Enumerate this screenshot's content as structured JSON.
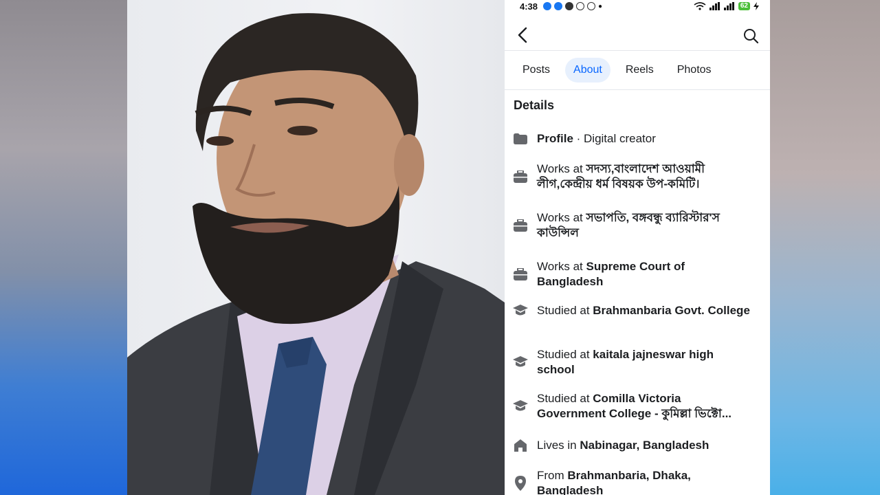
{
  "status_bar": {
    "time": "4:38",
    "battery": "62"
  },
  "header": {
    "back_icon": "chevron-left-icon",
    "search_icon": "search-icon"
  },
  "tabs": [
    {
      "label": "Posts",
      "active": false
    },
    {
      "label": "About",
      "active": true
    },
    {
      "label": "Reels",
      "active": false
    },
    {
      "label": "Photos",
      "active": false
    }
  ],
  "section_title": "Details",
  "details": [
    {
      "icon": "profile-icon",
      "prefix": "",
      "value": "Profile",
      "suffix": " · Digital creator"
    },
    {
      "icon": "briefcase-icon",
      "prefix": "Works at ",
      "value": "সদস্য,বাংলাদেশ আওয়ামী লীগ,কেন্দ্রীয় ধর্ম বিষয়ক উপ-কমিটি।",
      "suffix": ""
    },
    {
      "icon": "briefcase-icon",
      "prefix": "Works at ",
      "value": "সভাপতি, বঙ্গবন্ধু ব্যারিস্টার'স কাউন্সিল",
      "suffix": ""
    },
    {
      "icon": "briefcase-icon",
      "prefix": "Works at ",
      "value": "Supreme Court of Bangladesh",
      "suffix": ""
    },
    {
      "icon": "graduation-cap-icon",
      "prefix": "Studied at ",
      "value": "Brahmanbaria Govt. College",
      "suffix": ""
    },
    {
      "icon": "graduation-cap-icon",
      "prefix": "Studied at ",
      "value": "kaitala jajneswar high school",
      "suffix": ""
    },
    {
      "icon": "graduation-cap-icon",
      "prefix": "Studied at ",
      "value": "Comilla Victoria Government College - কুমিল্লা ভিক্টো...",
      "suffix": ""
    },
    {
      "icon": "home-icon",
      "prefix": "Lives in ",
      "value": "Nabinagar, Bangladesh",
      "suffix": ""
    },
    {
      "icon": "location-pin-icon",
      "prefix": "From ",
      "value": "Brahmanbaria, Dhaka, Bangladesh",
      "suffix": ""
    }
  ],
  "colors": {
    "accent": "#0866ff",
    "tab_active_bg": "#e7f0fd",
    "icon_gray": "#65676b"
  }
}
